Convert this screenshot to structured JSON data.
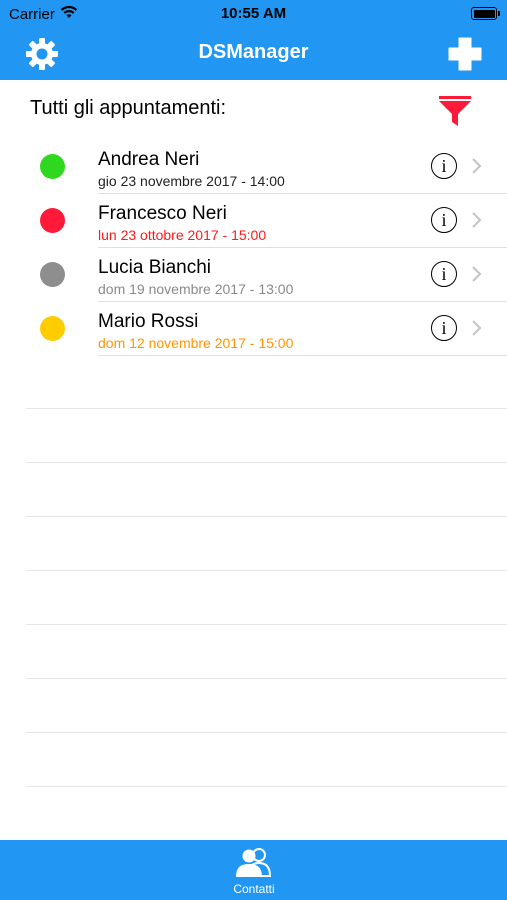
{
  "status_bar": {
    "carrier": "Carrier",
    "time": "10:55 AM"
  },
  "nav": {
    "title": "DSManager",
    "left_icon": "gear-icon",
    "right_icon": "plus-icon"
  },
  "list_header": {
    "title": "Tutti gli appuntamenti:",
    "filter_icon": "filter-icon"
  },
  "appointments": [
    {
      "name": "Andrea Neri",
      "date": "gio 23 novembre 2017 - 14:00",
      "dot_color": "#2fd81f",
      "date_color": "#222222"
    },
    {
      "name": "Francesco Neri",
      "date": "lun 23 ottobre 2017 - 15:00",
      "dot_color": "#ff1a3a",
      "date_color": "#ff1a1a"
    },
    {
      "name": "Lucia Bianchi",
      "date": "dom 19 novembre 2017 - 13:00",
      "dot_color": "#8e8e8e",
      "date_color": "#8a8a8a"
    },
    {
      "name": "Mario Rossi",
      "date": "dom 12 novembre 2017 - 15:00",
      "dot_color": "#ffcc00",
      "date_color": "#ff9500"
    }
  ],
  "tab_bar": {
    "tabs": [
      {
        "label": "Contatti",
        "icon": "contacts-icon"
      }
    ]
  },
  "colors": {
    "accent": "#2196f3",
    "filter": "#ff1a3a",
    "separator": "#e0e0e0"
  }
}
